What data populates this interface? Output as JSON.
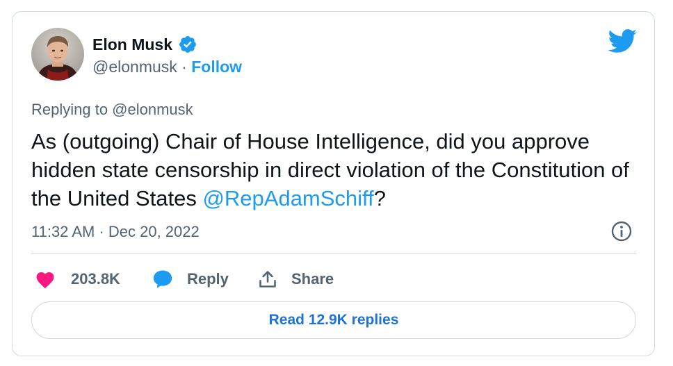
{
  "author": {
    "name": "Elon Musk",
    "handle": "@elonmusk",
    "separator": " · ",
    "follow_label": "Follow",
    "avatar_icon": "avatar-photo",
    "verified_icon": "verified-badge-icon"
  },
  "brand": {
    "icon": "twitter-bird-icon",
    "color": "#1d9bf0"
  },
  "tweet": {
    "replying_to": "Replying to @elonmusk",
    "text_before": "As (outgoing) Chair of House Intelligence, did you approve hidden state censorship in direct violation of the Constitution of the United States ",
    "mention": "@RepAdamSchiff",
    "text_after": "?",
    "timestamp": "11:32 AM · Dec 20, 2022"
  },
  "actions": {
    "like_count": "203.8K",
    "reply_label": "Reply",
    "share_label": "Share"
  },
  "read_replies_label": "Read 12.9K replies",
  "colors": {
    "accent": "#1d9bf0",
    "like": "#f91880",
    "text": "#0f1419",
    "secondary": "#536471",
    "border": "#cfd9de"
  }
}
